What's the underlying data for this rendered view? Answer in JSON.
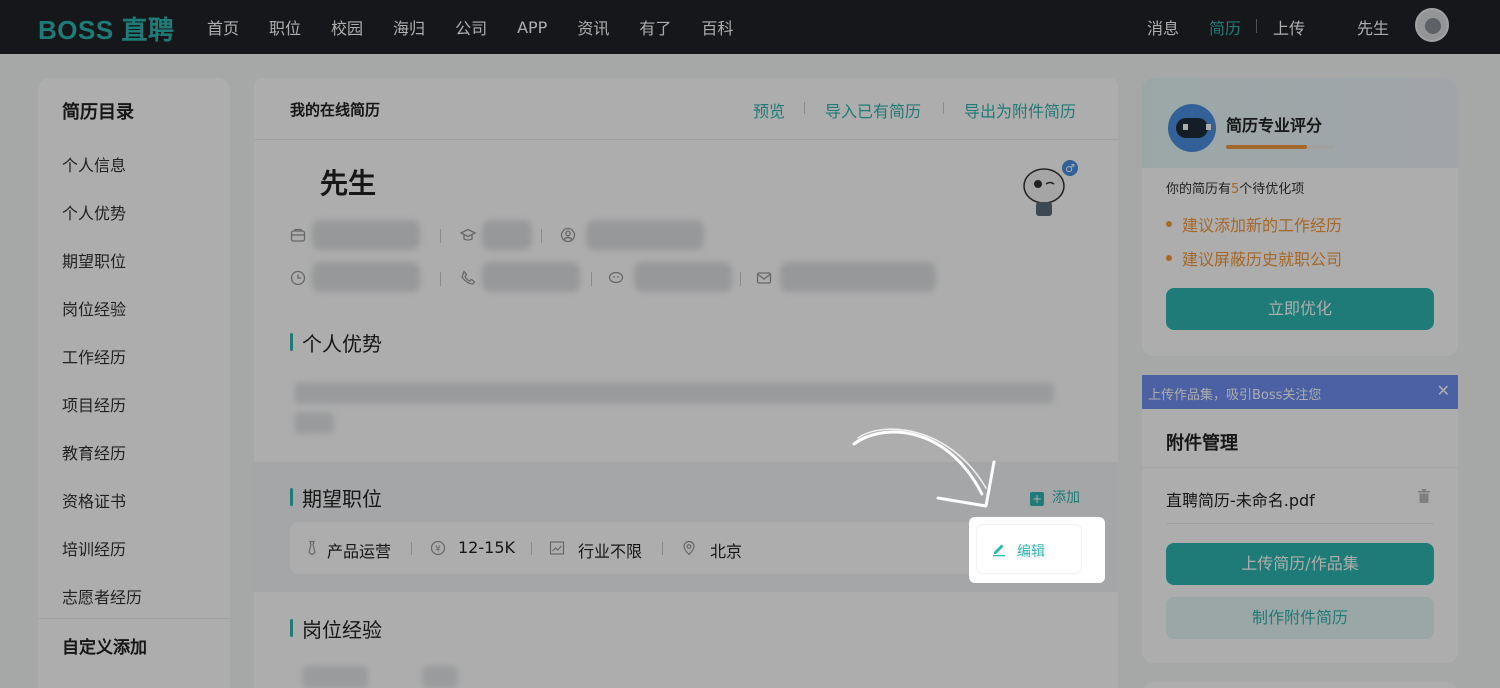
{
  "topbar": {
    "logo": "BOSS 直聘",
    "nav": [
      "首页",
      "职位",
      "校园",
      "海归",
      "公司",
      "APP",
      "资讯",
      "有了",
      "百科"
    ],
    "messages": "消息",
    "resume": "简历",
    "upload": "上传",
    "user": "先生"
  },
  "sidebar": {
    "title": "简历目录",
    "items": [
      "个人信息",
      "个人优势",
      "期望职位",
      "岗位经验",
      "工作经历",
      "项目经历",
      "教育经历",
      "资格证书",
      "培训经历",
      "志愿者经历"
    ],
    "custom_title": "自定义添加"
  },
  "main": {
    "title": "我的在线简历",
    "actions": {
      "preview": "预览",
      "import": "导入已有简历",
      "export": "导出为附件简历"
    },
    "name": "先生",
    "sections": {
      "advantage": "个人优势",
      "expectation": "期望职位",
      "experience": "岗位经验"
    },
    "add_label": "添加",
    "edit_label": "编辑",
    "expectation_row": {
      "position": "产品运营",
      "salary": "12-15K",
      "industry": "行业不限",
      "city": "北京"
    }
  },
  "score": {
    "title": "简历专业评分",
    "progress": 0.75,
    "desc_prefix": "你的简历有",
    "desc_count": "5",
    "desc_suffix": "个待优化项",
    "suggestions": [
      "建议添加新的工作经历",
      "建议屏蔽历史就职公司"
    ],
    "optimize_button": "立即优化"
  },
  "banner": {
    "text": "上传作品集，吸引Boss关注您",
    "close": "✕"
  },
  "attach": {
    "title": "附件管理",
    "file": "直聘简历-未命名.pdf",
    "upload_button": "上传简历/作品集",
    "make_button": "制作附件简历"
  },
  "colors": {
    "accent": "#2fb6b0",
    "warning": "#f19a3e",
    "topbar": "#202327",
    "banner": "#6f8ff2"
  }
}
